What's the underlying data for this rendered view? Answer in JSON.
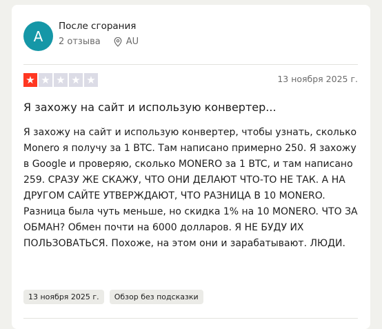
{
  "author": {
    "initial": "A",
    "name": "После сгорания",
    "reviews_count": "2 отзыва",
    "country": "AU",
    "avatar_color": "#1597a7"
  },
  "review": {
    "rating": 1,
    "max_rating": 5,
    "star_filled_color": "#ff3722",
    "star_empty_color": "#dcdce6",
    "date": "13 ноября 2025 г.",
    "title": "Я захожу на сайт и использую конвертер...",
    "body": "Я захожу на сайт и использую конвертер, чтобы узнать, сколько Monero я получу за 1 BTC. Там написано примерно 250. Я захожу в Google и проверяю, сколько MONERO за 1 BTC, и там написано 259. СРАЗУ ЖЕ СКАЖУ, ЧТО ОНИ ДЕЛАЮТ ЧТО-ТО НЕ ТАК. А НА ДРУГОМ САЙТЕ УТВЕРЖДАЮТ, ЧТО РАЗНИЦА В 10 MONERO. Разница была чуть меньше, но скидка 1% на 10 MONERO. ЧТО ЗА ОБМАН? Обмен почти на 6000 долларов. Я НЕ БУДУ ИХ ПОЛЬЗОВАТЬСЯ. Похоже, на этом они и зарабатывают. ЛЮДИ.",
    "tags": [
      "13 ноября 2025 г.",
      "Обзор без подсказки"
    ]
  },
  "icons": {
    "location": "location-pin-icon",
    "star": "star-icon"
  }
}
